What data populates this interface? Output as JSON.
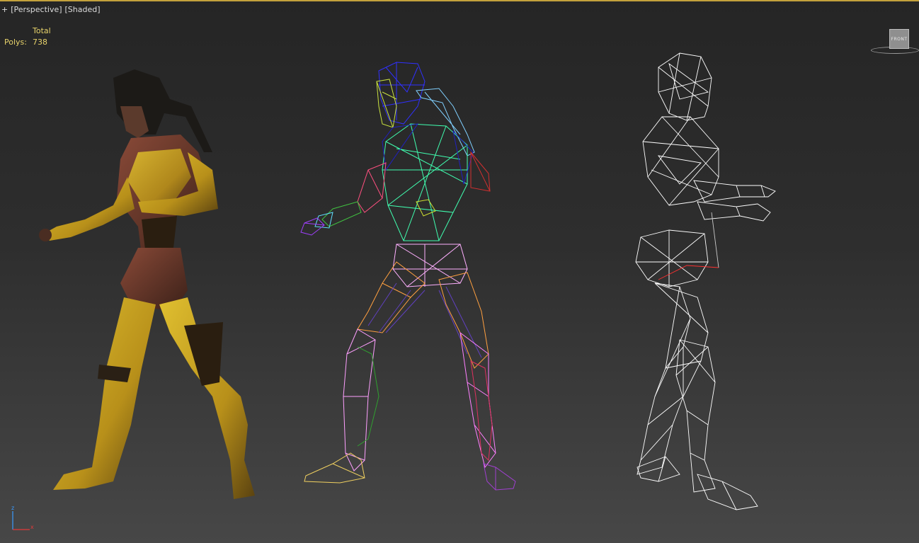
{
  "viewport": {
    "menu_plus": "+",
    "menu_view": "[Perspective",
    "menu_shading": "[Shaded]",
    "bracket_close": "]"
  },
  "stats": {
    "header": "Total",
    "polys_label": "Polys:",
    "polys_value": "738"
  },
  "viewcube": {
    "face_label": "FRONT"
  },
  "axis": {
    "z_label": "z",
    "x_label": "x",
    "z_color": "#3a9bff",
    "x_color": "#e23b3b"
  },
  "models": [
    {
      "name": "shaded-character",
      "render_mode": "textured",
      "colors": [
        "#c9a21c",
        "#6a3a2a",
        "#2b1e17"
      ]
    },
    {
      "name": "color-wireframe-character",
      "render_mode": "wireframe-by-element",
      "colors": [
        "#3a3aff",
        "#3dffa0",
        "#ff4da6",
        "#ffa94d",
        "#c8ff3d",
        "#a040ff"
      ]
    },
    {
      "name": "white-wireframe-character",
      "render_mode": "wireframe",
      "colors": [
        "#ffffff",
        "#ff2a2a"
      ]
    }
  ],
  "colors": {
    "accent_border": "#c4a13c",
    "stats_text": "#e8d36b"
  }
}
